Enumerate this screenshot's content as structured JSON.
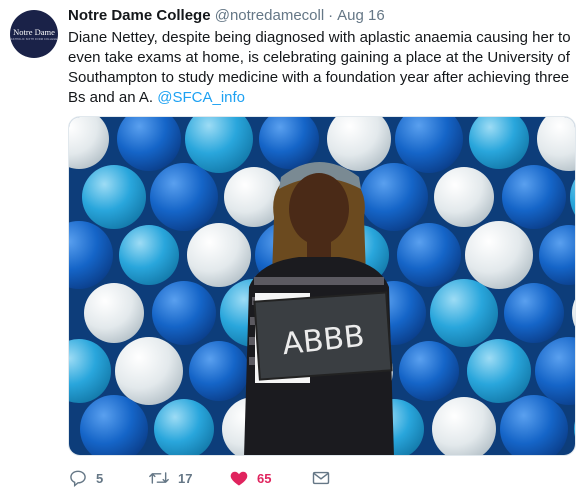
{
  "account": {
    "display_name": "Notre Dame College",
    "handle": "@notredamecoll",
    "separator": "·",
    "date": "Aug 16",
    "avatar_logo_text": "Notre Dame",
    "avatar_logo_subtext": "CATHOLIC SIXTH FORM COLLEGE"
  },
  "tweet": {
    "text": "Diane Nettey, despite being diagnosed with aplastic anaemia causing her to even take exams at home, is celebrating gaining a place at the University of Southampton to study medicine with a foundation year after achieving three Bs and an A.",
    "mention": "@SFCA_info"
  },
  "photo": {
    "sign_text": "ABBB"
  },
  "actions": {
    "reply_count": "5",
    "retweet_count": "17",
    "like_count": "65"
  },
  "colors": {
    "like": "#e0245e",
    "mention": "#1da1f2",
    "secondary": "#657786",
    "balloon_dark": "#1565c8",
    "balloon_light": "#e6ebee",
    "balloon_cyan": "#29a6dc"
  },
  "icons": [
    "reply-icon",
    "retweet-icon",
    "heart-icon",
    "direct-message-icon"
  ]
}
